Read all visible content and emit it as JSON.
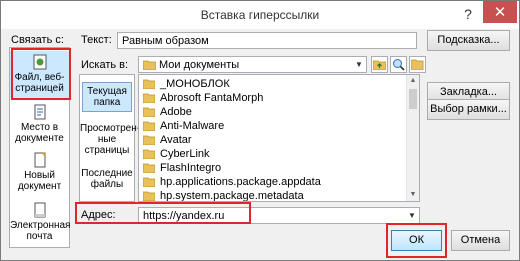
{
  "window": {
    "title": "Вставка гиперссылки"
  },
  "controls": {
    "help": "?",
    "close": "✕"
  },
  "link_to": {
    "label": "Связать с:"
  },
  "text_field": {
    "label": "Текст:",
    "value": "Равным образом"
  },
  "screentip_button": "Подсказка...",
  "look_in": {
    "label": "Искать в:",
    "value": "Мои документы"
  },
  "sidebar": [
    {
      "label": "Файл, веб-страницей",
      "icon": "web-page-icon"
    },
    {
      "label": "Место в документе",
      "icon": "place-in-document-icon"
    },
    {
      "label": "Новый документ",
      "icon": "new-document-icon"
    },
    {
      "label": "Электронная почта",
      "icon": "email-icon"
    }
  ],
  "places": [
    {
      "label": "Текущая папка"
    },
    {
      "label": "Просмотрен-ные страницы"
    },
    {
      "label": "Последние файлы"
    }
  ],
  "files": [
    "_МОНОБЛОК",
    "Abrosoft FantaMorph",
    "Adobe",
    "Anti-Malware",
    "Avatar",
    "CyberLink",
    "FlashIntegro",
    "hp.applications.package.appdata",
    "hp.system.package.metadata"
  ],
  "bookmark_button": "Закладка...",
  "target_frame_button": "Выбор рамки...",
  "address": {
    "label": "Адрес:",
    "value": "https://yandex.ru"
  },
  "ok_button": "ОК",
  "cancel_button": "Отмена",
  "colors": {
    "highlight": "#e0262d",
    "selection": "#cce8ff",
    "folder": "#e8c15a"
  }
}
